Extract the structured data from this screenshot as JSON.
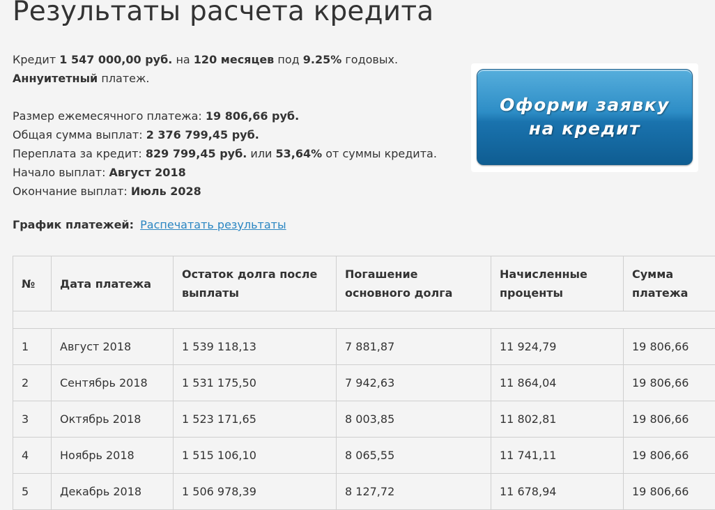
{
  "page": {
    "title": "Результаты расчета кредита"
  },
  "summary": {
    "line1": {
      "prefix": "Кредит ",
      "amount": "1 547 000,00 руб.",
      "mid1": " на ",
      "months": "120 месяцев",
      "mid2": " под ",
      "rate": "9.25%",
      "suffix": " годовых."
    },
    "line2": {
      "type": "Аннуитетный",
      "suffix": " платеж."
    },
    "monthly": {
      "label": "Размер ежемесячного платежа: ",
      "value": "19 806,66 руб."
    },
    "total": {
      "label": "Общая сумма выплат: ",
      "value": "2 376 799,45 руб."
    },
    "overpay": {
      "label": "Переплата за кредит: ",
      "value": "829 799,45 руб.",
      "mid": " или ",
      "percent": "53,64%",
      "suffix": " от суммы кредита."
    },
    "start": {
      "label": "Начало выплат: ",
      "value": "Август 2018"
    },
    "end": {
      "label": "Окончание выплат: ",
      "value": "Июль 2028"
    }
  },
  "cta": {
    "line1": "Оформи заявку",
    "line2": "на кредит"
  },
  "schedule": {
    "label": "График платежей:",
    "print_link": "Распечатать результаты",
    "columns": [
      "№",
      "Дата платежа",
      "Остаток долга после выплаты",
      "Погашение основного долга",
      "Начисленные проценты",
      "Сумма платежа"
    ],
    "rows": [
      [
        "1",
        "Август 2018",
        "1 539 118,13",
        "7 881,87",
        "11 924,79",
        "19 806,66"
      ],
      [
        "2",
        "Сентябрь 2018",
        "1 531 175,50",
        "7 942,63",
        "11 864,04",
        "19 806,66"
      ],
      [
        "3",
        "Октябрь 2018",
        "1 523 171,65",
        "8 003,85",
        "11 802,81",
        "19 806,66"
      ],
      [
        "4",
        "Ноябрь 2018",
        "1 515 106,10",
        "8 065,55",
        "11 741,11",
        "19 806,66"
      ],
      [
        "5",
        "Декабрь 2018",
        "1 506 978,39",
        "8 127,72",
        "11 678,94",
        "19 806,66"
      ]
    ]
  }
}
